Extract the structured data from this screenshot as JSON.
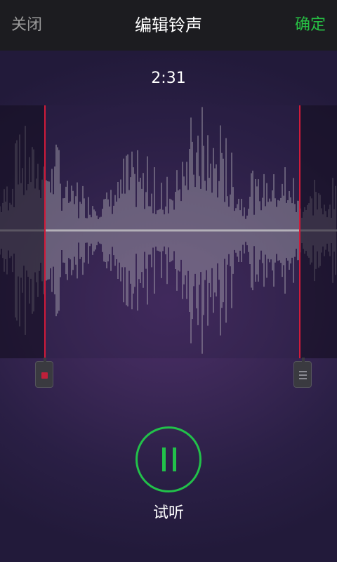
{
  "header": {
    "close_label": "关闭",
    "title": "编辑铃声",
    "confirm_label": "确定"
  },
  "player": {
    "duration": "2:31",
    "listen_label": "试听",
    "state": "playing"
  },
  "colors": {
    "accent_green": "#22c14a",
    "marker_red": "#d11b3a",
    "waveform": "#b3b0b8"
  },
  "icons": {
    "play_button_icon": "pause-icon",
    "left_handle_icon": "stop-square-icon",
    "right_handle_icon": "menu-lines-icon"
  }
}
